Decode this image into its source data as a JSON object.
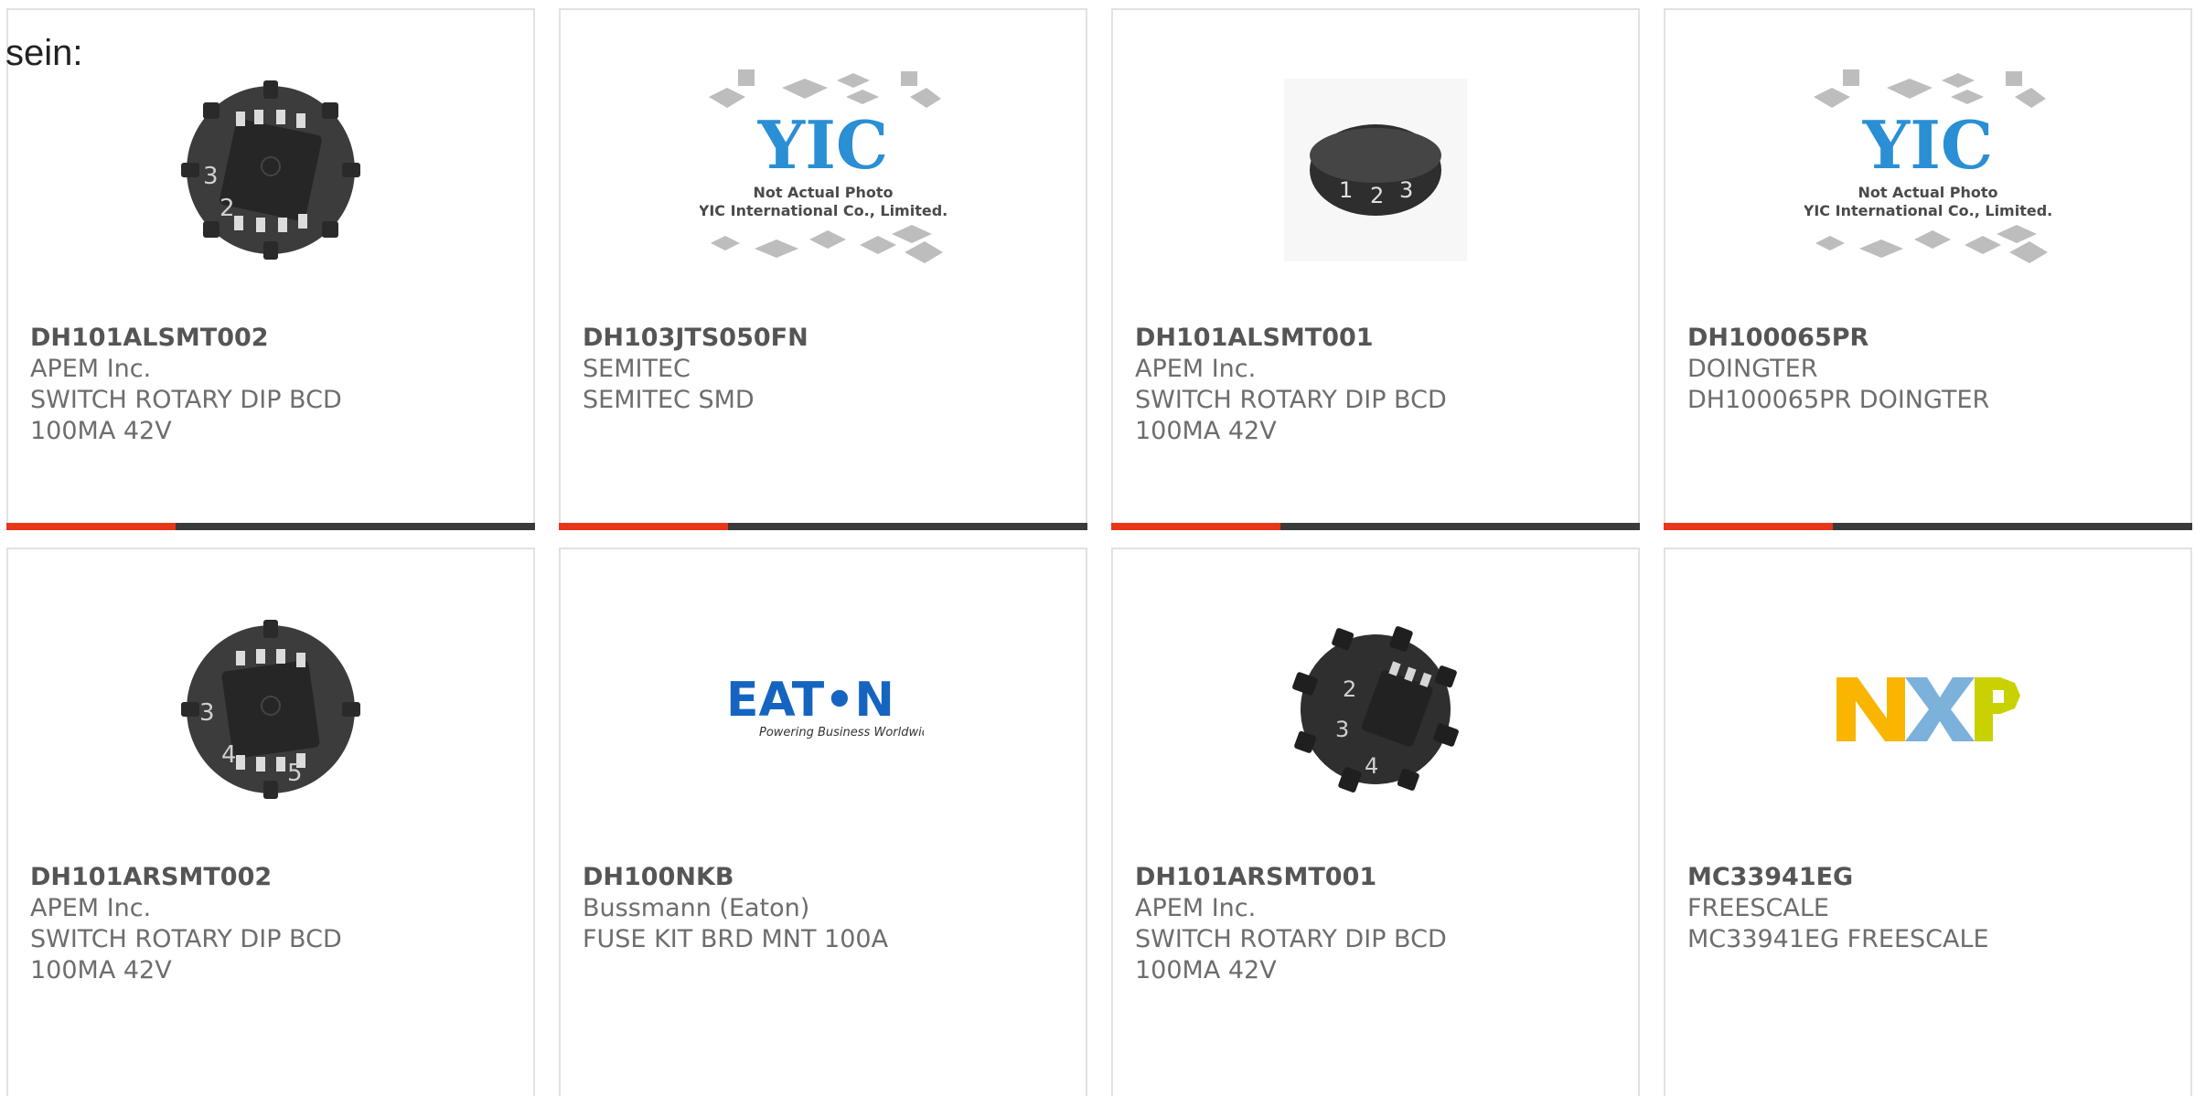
{
  "page": {
    "lead_text": "sein:"
  },
  "theme": {
    "accent": "#e8361a",
    "bar_dark": "#3a3a3a",
    "border": "#e2e2e2",
    "text": "#6d6d6d"
  },
  "products": [
    {
      "part": "DH101ALSMT002",
      "maker": "APEM Inc.",
      "desc1": "SWITCH ROTARY DIP BCD",
      "desc2": "100MA 42V",
      "image": "rotary-dip-switch-icon",
      "bar_progress": 0.32
    },
    {
      "part": "DH103JTS050FN",
      "maker": "SEMITEC",
      "desc1": "SEMITEC SMD",
      "desc2": "",
      "image": "yic-placeholder-icon",
      "placeholder_line1": "Not Actual Photo",
      "placeholder_line2": "YIC International Co., Limited.",
      "bar_progress": 0.32
    },
    {
      "part": "DH101ALSMT001",
      "maker": "APEM Inc.",
      "desc1": "SWITCH ROTARY DIP BCD",
      "desc2": "100MA 42V",
      "image": "rotary-dip-switch-icon",
      "bar_progress": 0.32
    },
    {
      "part": "DH100065PR",
      "maker": "DOINGTER",
      "desc1": "DH100065PR DOINGTER",
      "desc2": "",
      "image": "yic-placeholder-icon",
      "placeholder_line1": "Not Actual Photo",
      "placeholder_line2": "YIC International Co., Limited.",
      "bar_progress": 0.32
    },
    {
      "part": "DH101ARSMT002",
      "maker": "APEM Inc.",
      "desc1": "SWITCH ROTARY DIP BCD",
      "desc2": "100MA 42V",
      "image": "rotary-dip-switch-icon"
    },
    {
      "part": "DH100NKB",
      "maker": "Bussmann (Eaton)",
      "desc1": "FUSE KIT BRD MNT 100A",
      "desc2": "",
      "image": "eaton-logo",
      "logo_text": "EAT•N",
      "logo_tagline": "Powering Business Worldwide"
    },
    {
      "part": "DH101ARSMT001",
      "maker": "APEM Inc.",
      "desc1": "SWITCH ROTARY DIP BCD",
      "desc2": "100MA 42V",
      "image": "rotary-dip-switch-icon"
    },
    {
      "part": "MC33941EG",
      "maker": "FREESCALE",
      "desc1": "MC33941EG FREESCALE",
      "desc2": "",
      "image": "nxp-logo",
      "logo_text": "NXP"
    }
  ]
}
